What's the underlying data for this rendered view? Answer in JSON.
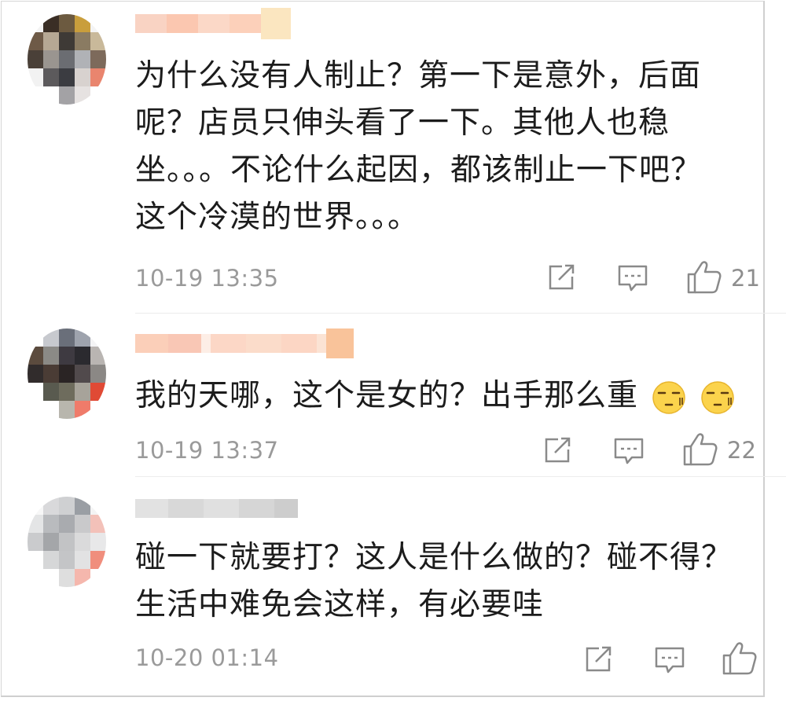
{
  "comments": [
    {
      "text": "为什么没有人制止？第一下是意外，后面呢？店员只伸头看了一下。其他人也稳坐。。。不论什么起因，都该制止一下吧？这个冷漠的世界。。。",
      "lines": [
        "为什么没有人制止？第一下是意外，后面",
        "呢？店员只伸头看了一下。其他人也稳",
        "坐。。。不论什么起因，都该制止一下吧？",
        "这个冷漠的世界。。。"
      ],
      "timestamp": "10-19 13:35",
      "likes": "21"
    },
    {
      "text": "我的天哪，这个是女的？出手那么重",
      "lines": [
        "我的天哪，这个是女的？出手那么重"
      ],
      "timestamp": "10-19 13:37",
      "likes": "22"
    },
    {
      "text": "碰一下就要打？这人是什么做的？碰不得？生活中难免会这样，有必要哇",
      "lines": [
        "碰一下就要打？这人是什么做的？碰不得？",
        "生活中难免会这样，有必要哇"
      ],
      "timestamp": "10-20 01:14",
      "likes": ""
    }
  ],
  "icons": {
    "share": "share-icon",
    "reply": "comment-icon",
    "like": "thumbs-up-icon",
    "emoji": "speechless-face-emoji"
  },
  "colors": {
    "text": "#1c1c1c",
    "meta": "#9a9a9a",
    "icon": "#8a8a8a"
  }
}
